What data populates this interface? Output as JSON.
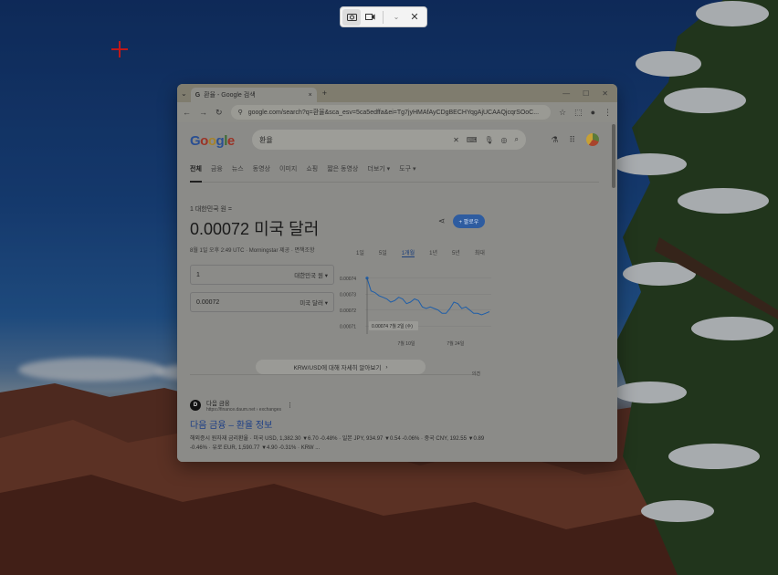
{
  "snip_toolbar": {
    "mode_icons": [
      "camera-icon",
      "video-icon"
    ],
    "more_icon": "chevron-down-icon",
    "close_icon": "close-icon"
  },
  "browser": {
    "tab": {
      "title": "환율 - Google 검색",
      "close": "×"
    },
    "new_tab": "+",
    "address": "google.com/search?q=환율&sca_esv=5ca5edffa&ei=Tg7jyHMAfAyCDgBECHYqgAjUCAAQjcqrSOoC...",
    "search": {
      "query": "환율",
      "logo": "Google"
    },
    "nav_tabs": [
      "전체",
      "금융",
      "뉴스",
      "동영상",
      "이미지",
      "쇼핑",
      "짧은 동영상",
      "더보기 ▾",
      "도구 ▾"
    ],
    "converter": {
      "subtitle": "1 대한민국 원 =",
      "value": "0.00072 미국 달러",
      "date": "8월 1일 오후 2:49 UTC · Morningstar 제공 · 면책조항",
      "follow_label": "+ 팔로우",
      "from_amount": "1",
      "from_unit": "대한민국 원 ▾",
      "to_amount": "0.00072",
      "to_unit": "미국 달러 ▾",
      "ranges": [
        "1일",
        "5일",
        "1개월",
        "1년",
        "5년",
        "최대"
      ],
      "active_range": "1개월",
      "tooltip": "0.00074 7월 2일 (수)",
      "more_label": "KRW/USD에 대해 자세히 알아보기",
      "feedback": "의견"
    },
    "result": {
      "favicon_letter": "D",
      "site_name": "다음 금융",
      "site_url": "https://finance.daum.net › exchanges",
      "title": "다음 금융 – 환율 정보",
      "snippet": "해외증시 원자재 금리환율 · 미국 USD, 1,382.30 ▼6.70 -0.48% · 일본 JPY, 934.97 ▼0.54 -0.06% · 중국 CNY, 192.55 ▼0.89 -0.46% · 유로 EUR, 1,590.77 ▼4.90 -0.31% · KRW ..."
    }
  },
  "chart_data": {
    "type": "line",
    "title": "",
    "xlabel": "",
    "ylabel": "",
    "ylim": [
      0.000705,
      0.000745
    ],
    "yticks": [
      "0.00074",
      "0.00073",
      "0.00072",
      "0.00071"
    ],
    "xticks": [
      "7월 10일",
      "7월 24일"
    ],
    "series": [
      {
        "values": [
          0.00074,
          0.000732,
          0.000731,
          0.000729,
          0.000728,
          0.000727,
          0.000725,
          0.000726,
          0.000728,
          0.000727,
          0.000724,
          0.000725,
          0.000727,
          0.000726,
          0.000722,
          0.000721,
          0.000722,
          0.000721,
          0.00072,
          0.000718,
          0.000718,
          0.000721,
          0.000725,
          0.000724,
          0.000721,
          0.000722,
          0.00072,
          0.000718,
          0.000718,
          0.000717,
          0.000718,
          0.000719
        ]
      }
    ],
    "colors": {
      "line": "#1f5ea8"
    }
  }
}
